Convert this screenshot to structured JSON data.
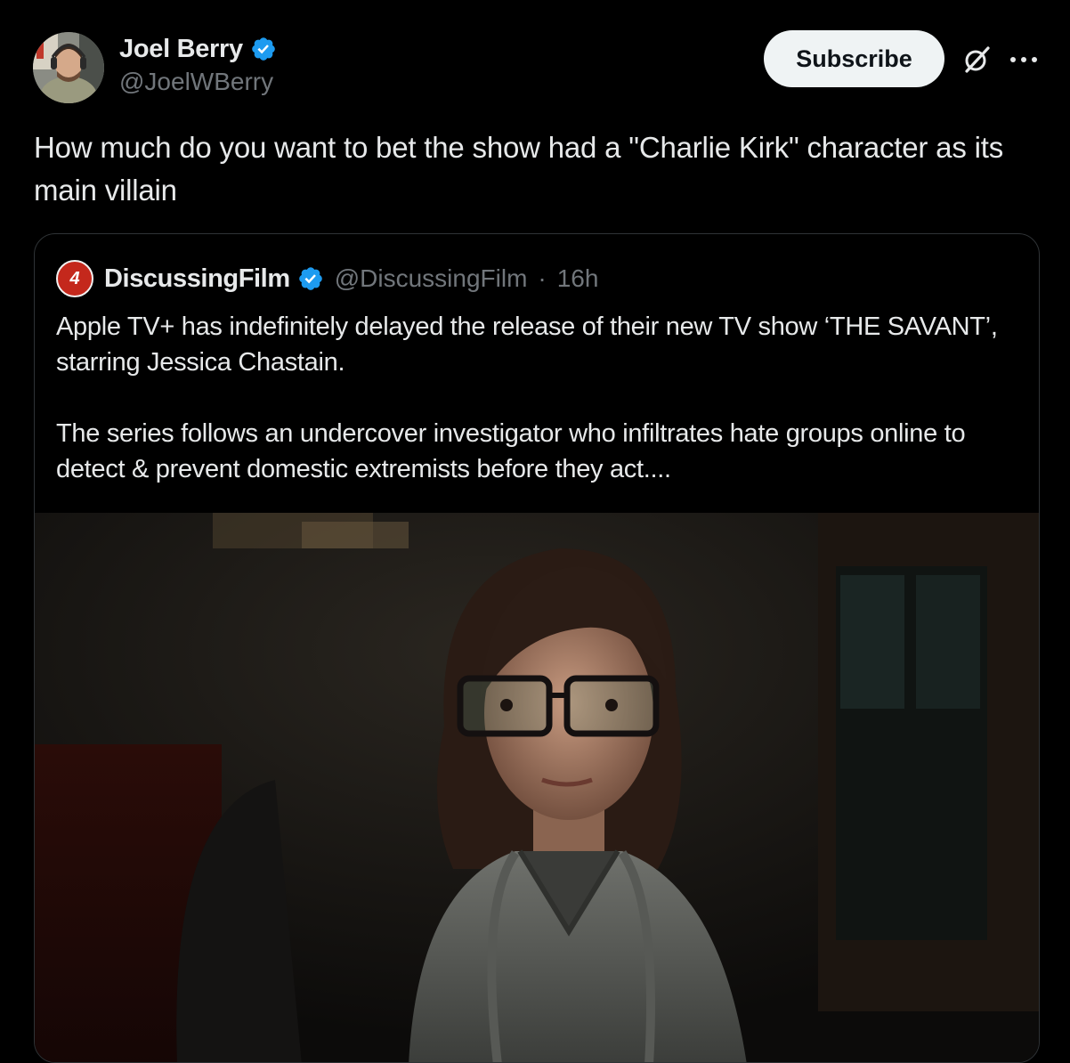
{
  "tweet": {
    "author": {
      "name": "Joel Berry",
      "handle": "@JoelWBerry",
      "avatar_icon": "person-with-headphones-avatar"
    },
    "subscribe_label": "Subscribe",
    "text": "How much do you want to bet the show had a \"Charlie Kirk\" character as its main villain"
  },
  "quote": {
    "avatar_letter": "4",
    "name": "DiscussingFilm",
    "handle": "@DiscussingFilm",
    "separator": "·",
    "time": "16h",
    "paragraphs": [
      "Apple TV+ has indefinitely delayed the release of their new TV show ‘THE SAVANT’, starring Jessica Chastain.",
      "The series follows an undercover investigator who infiltrates hate groups online to detect & prevent domestic extremists before they act...."
    ],
    "media_icon": "still-woman-with-glasses-image"
  },
  "colors": {
    "background": "#000000",
    "text": "#e7e9ea",
    "secondary_text": "#71767b",
    "verified": "#1d9bf0",
    "border": "#2f3336",
    "subscribe_bg": "#eff3f4"
  }
}
